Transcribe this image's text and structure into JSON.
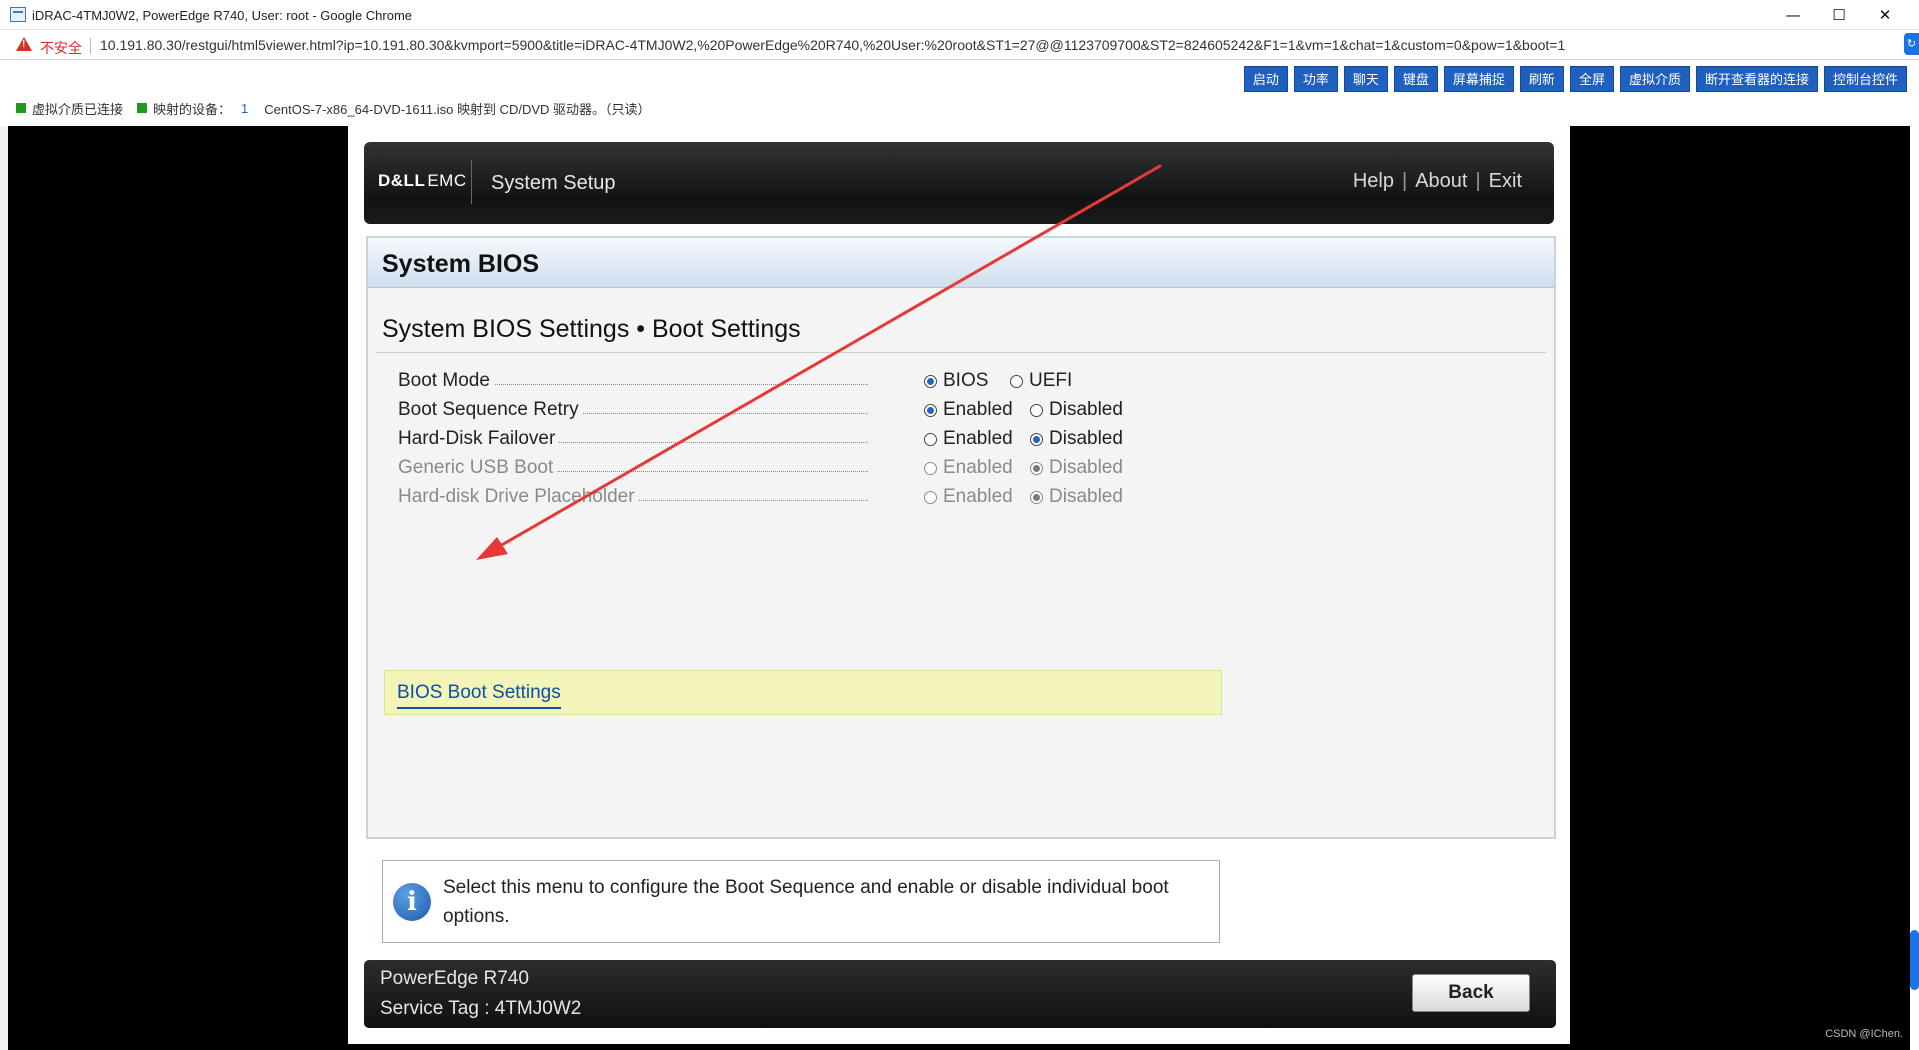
{
  "window": {
    "title": "iDRAC-4TMJ0W2, PowerEdge R740, User: root - Google Chrome",
    "minimize": "—",
    "maximize": "☐",
    "close": "✕"
  },
  "address_bar": {
    "security_label": "不安全",
    "url": "10.191.80.30/restgui/html5viewer.html?ip=10.191.80.30&kvmport=5900&title=iDRAC-4TMJ0W2,%20PowerEdge%20R740,%20User:%20root&ST1=27@@1123709700&ST2=824605242&F1=1&vm=1&chat=1&custom=0&pow=1&boot=1"
  },
  "viewer_toolbar": {
    "buttons": [
      "启动",
      "功率",
      "聊天",
      "键盘",
      "屏幕捕捉",
      "刷新",
      "全屏",
      "虚拟介质",
      "断开查看器的连接",
      "控制台控件"
    ],
    "status": {
      "media_connected": "虚拟介质已连接",
      "mapped_devices_label": "映射的设备：",
      "mapped_count": "1",
      "mapped_detail": "CentOS-7-x86_64-DVD-1611.iso 映射到 CD/DVD 驱动器。（只读）"
    }
  },
  "bios": {
    "brand": {
      "dell": "D&LL",
      "emc": "EMC"
    },
    "header_title": "System Setup",
    "header_links": {
      "help": "Help",
      "about": "About",
      "exit": "Exit",
      "sep": "|"
    },
    "panel_title": "System BIOS",
    "section_title": "System BIOS Settings • Boot Settings",
    "settings": [
      {
        "label": "Boot Mode",
        "options": [
          "BIOS",
          "UEFI"
        ],
        "selected": "BIOS",
        "enabled": true
      },
      {
        "label": "Boot Sequence Retry",
        "options": [
          "Enabled",
          "Disabled"
        ],
        "selected": "Enabled",
        "enabled": true
      },
      {
        "label": "Hard-Disk Failover",
        "options": [
          "Enabled",
          "Disabled"
        ],
        "selected": "Disabled",
        "enabled": true
      },
      {
        "label": "Generic USB Boot",
        "options": [
          "Enabled",
          "Disabled"
        ],
        "selected": "Disabled",
        "enabled": false
      },
      {
        "label": "Hard-disk Drive Placeholder",
        "options": [
          "Enabled",
          "Disabled"
        ],
        "selected": "Disabled",
        "enabled": false
      }
    ],
    "submenu_link": "BIOS Boot Settings",
    "help_text": "Select this menu to configure the Boot Sequence and enable or disable individual boot options.",
    "footer": {
      "model": "PowerEdge R740",
      "service_tag": "Service Tag : 4TMJ0W2",
      "back_label": "Back"
    },
    "annotation_color": "#e53935"
  },
  "watermark": "CSDN @IChen."
}
